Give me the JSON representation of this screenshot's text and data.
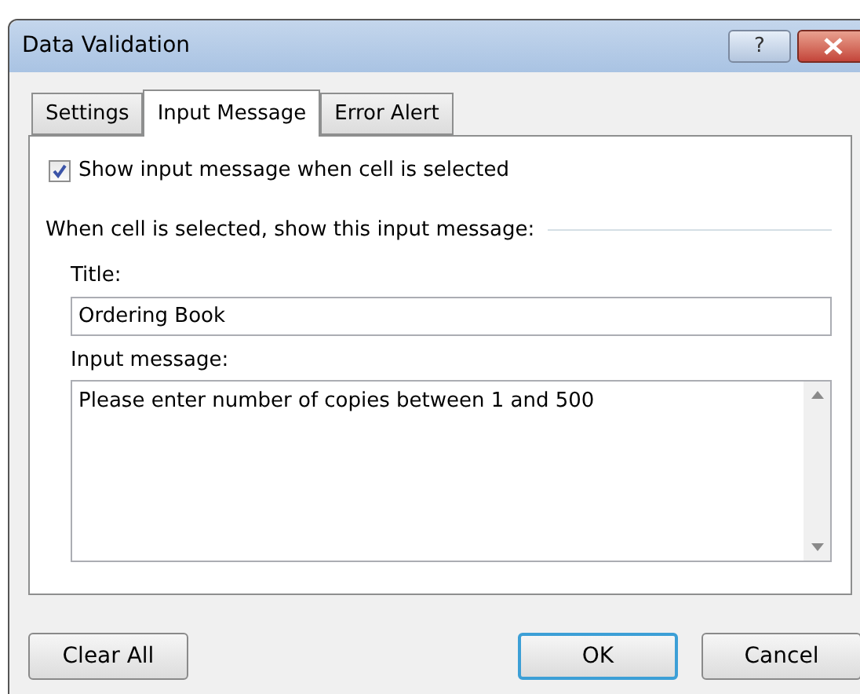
{
  "window": {
    "title": "Data Validation",
    "help_button": "?"
  },
  "tabs": [
    {
      "label": "Settings",
      "selected": false
    },
    {
      "label": "Input Message",
      "selected": true
    },
    {
      "label": "Error Alert",
      "selected": false
    }
  ],
  "show_message": {
    "label": "Show input message when cell is selected",
    "checked": true
  },
  "group_label": "When cell is selected, show this input message:",
  "title_field": {
    "label": "Title:",
    "value": "Ordering Book"
  },
  "message_field": {
    "label": "Input message:",
    "value": "Please enter number of copies between 1 and 500"
  },
  "buttons": [
    {
      "label": "Clear All",
      "kind": "left",
      "default": false
    },
    {
      "label": "OK",
      "kind": "right",
      "default": true
    },
    {
      "label": "Cancel",
      "kind": "right",
      "default": false
    }
  ]
}
